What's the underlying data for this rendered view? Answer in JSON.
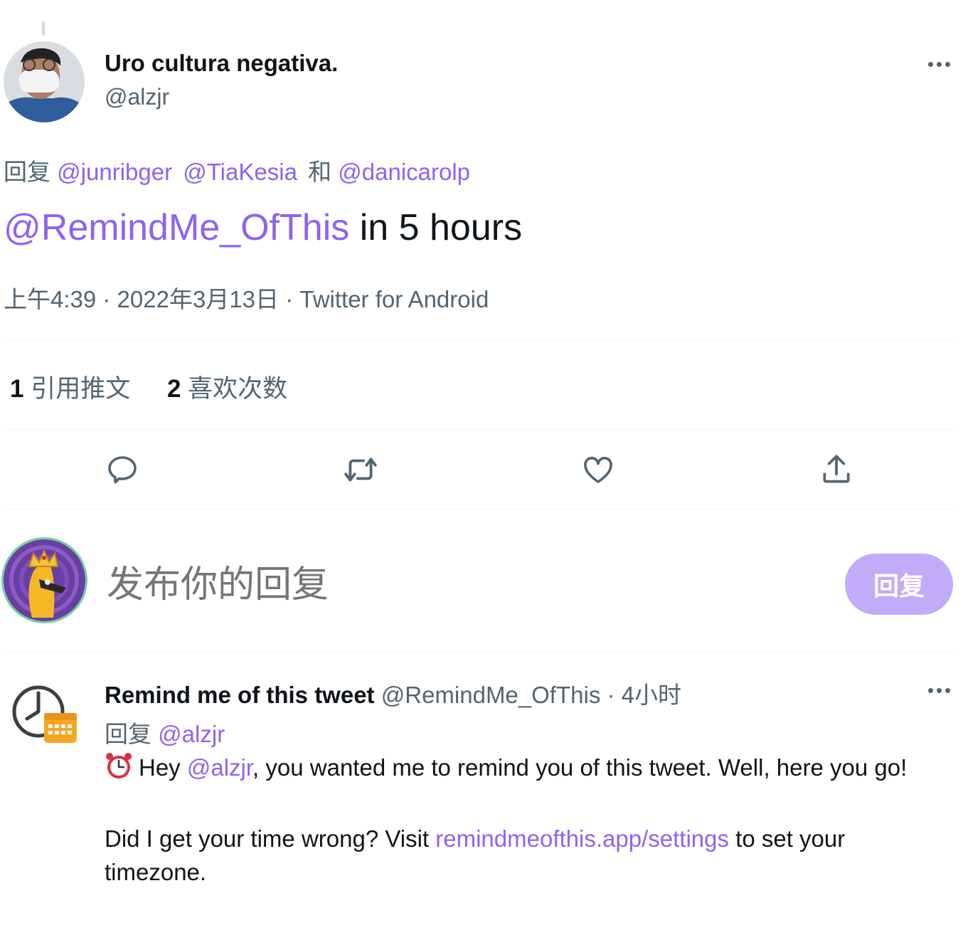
{
  "tweet": {
    "author_name": "Uro cultura negativa.",
    "author_handle": "@alzjr",
    "reply_prefix": "回复",
    "reply_to": [
      "@junribger",
      "@TiaKesia"
    ],
    "reply_and": "和",
    "reply_last": "@danicarolp",
    "mention": "@RemindMe_OfThis",
    "text_rest": " in 5 hours",
    "meta": "上午4:39 · 2022年3月13日 · Twitter for Android"
  },
  "stats": {
    "quotes_count": "1",
    "quotes_label": "引用推文",
    "likes_count": "2",
    "likes_label": "喜欢次数"
  },
  "icons": [
    "reply-icon",
    "retweet-icon",
    "like-icon",
    "share-icon",
    "more-icon",
    "alarm-clock-icon"
  ],
  "compose": {
    "placeholder": "发布你的回复",
    "button_label": "回复"
  },
  "reply": {
    "author_name": "Remind me of this tweet",
    "author_handle": "@RemindMe_OfThis",
    "time": " · 4小时",
    "reply_prefix": "回复",
    "reply_to": "@alzjr",
    "body_hey": "Hey ",
    "body_mention": "@alzjr",
    "body_rest": ", you wanted me to remind you of this tweet. Well, here you go!",
    "body2_start": "Did I get your time wrong? Visit ",
    "body2_link": "remindmeofthis.app/settings",
    "body2_end": " to set your timezone."
  },
  "colors": {
    "link": "#8c63f2",
    "reply_button": "#c0acf8",
    "secondary_text": "#536471"
  }
}
